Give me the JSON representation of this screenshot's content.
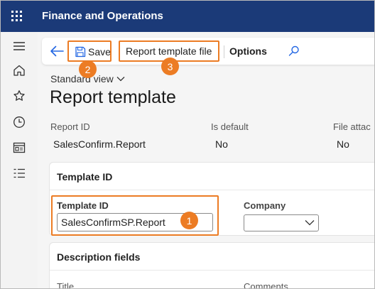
{
  "app": {
    "title": "Finance and Operations"
  },
  "rail": {
    "icons": [
      "hamburger-icon",
      "home-icon",
      "star-icon",
      "clock-icon",
      "workspace-icon",
      "list-icon"
    ]
  },
  "toolbar": {
    "save_label": "Save",
    "report_template_file_label": "Report template file",
    "options_label": "Options"
  },
  "page": {
    "view_label": "Standard view",
    "title": "Report template"
  },
  "summary": {
    "report_id_label": "Report ID",
    "report_id_value": "SalesConfirm.Report",
    "is_default_label": "Is default",
    "is_default_value": "No",
    "file_attached_label": "File attac",
    "file_attached_value": "No"
  },
  "template_section": {
    "heading": "Template ID",
    "template_id_label": "Template ID",
    "template_id_value": "SalesConfirmSP.Report",
    "company_label": "Company",
    "company_value": ""
  },
  "description_section": {
    "heading": "Description fields",
    "title_label": "Title",
    "comments_label": "Comments"
  },
  "callouts": [
    "1",
    "2",
    "3"
  ],
  "colors": {
    "appbar": "#1b3a78",
    "callout": "#ec7c24",
    "accent": "#2266e3"
  }
}
